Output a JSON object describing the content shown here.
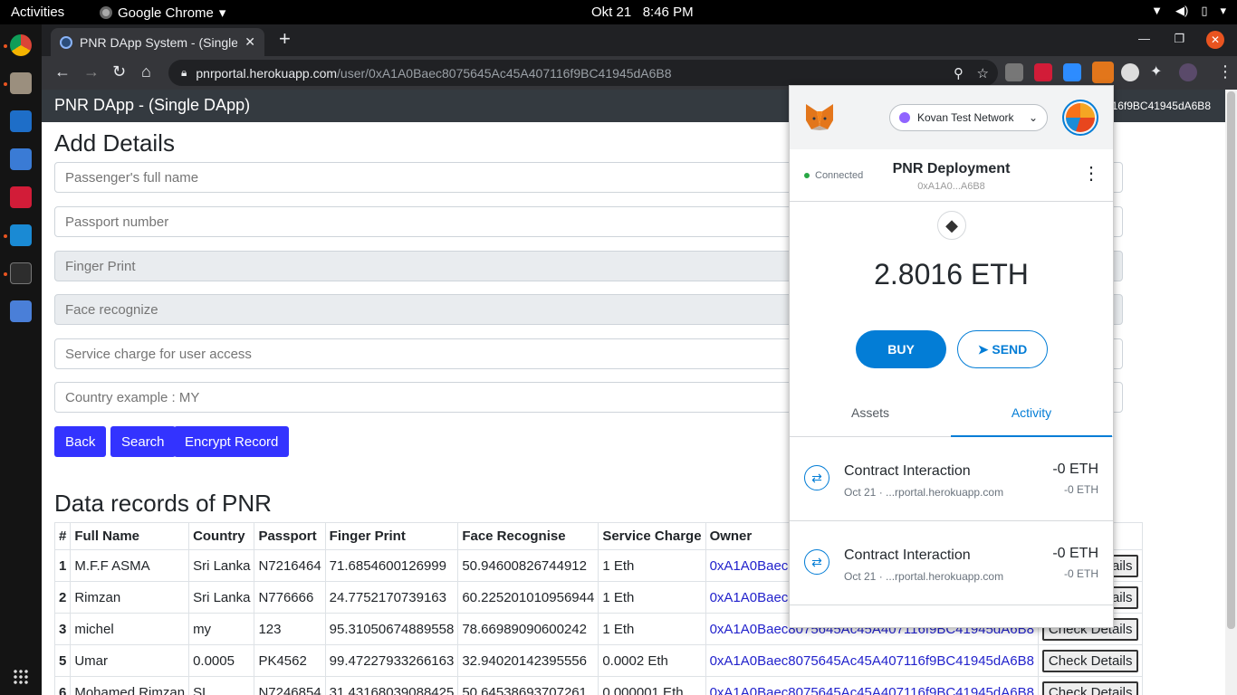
{
  "os": {
    "activities": "Activities",
    "app_name": "Google Chrome",
    "date": "Okt 21",
    "time": "8:46 PM"
  },
  "browser": {
    "tab_title": "PNR DApp System - (Single",
    "url_host": "pnrportal.herokuapp.com",
    "url_path": "/user/0xA1A0Baec8075645Ac45A407116f9BC41945dA6B8"
  },
  "page": {
    "brand": "PNR DApp - (Single DApp)",
    "account_address_suffix": "16f9BC41945dA6B8",
    "add_details_heading": "Add Details",
    "placeholders": {
      "full_name": "Passenger's full name",
      "passport": "Passport number",
      "finger_print": "Finger Print",
      "face": "Face recognize",
      "service_charge": "Service charge for user access",
      "country": "Country example : MY"
    },
    "buttons": {
      "back": "Back",
      "search": "Search",
      "encrypt": "Encrypt Record"
    },
    "records_heading": "Data records of PNR",
    "table": {
      "headers": [
        "#",
        "Full Name",
        "Country",
        "Passport",
        "Finger Print",
        "Face Recognise",
        "Service Charge",
        "Owner",
        ""
      ],
      "rows": [
        {
          "id": "1",
          "name": "M.F.F ASMA",
          "country": "Sri Lanka",
          "passport": "N7216464",
          "finger": "71.6854600126999",
          "face": "50.94600826744912",
          "charge": "1 Eth",
          "owner": "0xA1A0Baec8075645Ac45A407116f9BC41945dA6B8",
          "action": "Check Details"
        },
        {
          "id": "2",
          "name": "Rimzan",
          "country": "Sri Lanka",
          "passport": "N776666",
          "finger": "24.7752170739163",
          "face": "60.225201010956944",
          "charge": "1 Eth",
          "owner": "0xA1A0Baec8075645Ac45A407116f9BC41945dA6B8",
          "action": "Check Details"
        },
        {
          "id": "3",
          "name": "michel",
          "country": "my",
          "passport": "123",
          "finger": "95.31050674889558",
          "face": "78.66989090600242",
          "charge": "1 Eth",
          "owner": "0xA1A0Baec8075645Ac45A407116f9BC41945dA6B8",
          "action": "Check Details"
        },
        {
          "id": "5",
          "name": "Umar",
          "country": "0.0005",
          "passport": "PK4562",
          "finger": "99.47227933266163",
          "face": "32.94020142395556",
          "charge": "0.0002 Eth",
          "owner": "0xA1A0Baec8075645Ac45A407116f9BC41945dA6B8",
          "action": "Check Details"
        },
        {
          "id": "6",
          "name": "Mohamed Rimzan",
          "country": "SL",
          "passport": "N7246854",
          "finger": "31.43168039088425",
          "face": "50.64538693707261",
          "charge": "0.000001 Eth",
          "owner": "0xA1A0Baec8075645Ac45A407116f9BC41945dA6B8",
          "action": "Check Details"
        }
      ]
    }
  },
  "metamask": {
    "network": "Kovan Test Network",
    "connected": "Connected",
    "account_name": "PNR Deployment",
    "account_address": "0xA1A0...A6B8",
    "balance_amount": "2.8016",
    "balance_unit": "ETH",
    "buy": "BUY",
    "send": "SEND",
    "tab_assets": "Assets",
    "tab_activity": "Activity",
    "transactions": [
      {
        "title": "Contract Interaction",
        "date": "Oct 21",
        "origin": "...rportal.herokuapp.com",
        "amount": "-0 ETH",
        "sub_amount": "-0 ETH"
      },
      {
        "title": "Contract Interaction",
        "date": "Oct 21",
        "origin": "...rportal.herokuapp.com",
        "amount": "-0 ETH",
        "sub_amount": "-0 ETH"
      }
    ]
  },
  "colors": {
    "primary_button": "#3333ff",
    "navbar": "#343a40",
    "metamask_blue": "#037dd6",
    "ubuntu_orange": "#e95420"
  },
  "icons": [
    "chrome-icon",
    "files-icon",
    "writer-icon",
    "screenshot-icon",
    "mendeley-icon",
    "vscode-icon",
    "terminal-icon",
    "app-grid-icon",
    "metamask-fox-icon",
    "ethereum-icon",
    "send-arrow-icon",
    "transaction-icon"
  ]
}
